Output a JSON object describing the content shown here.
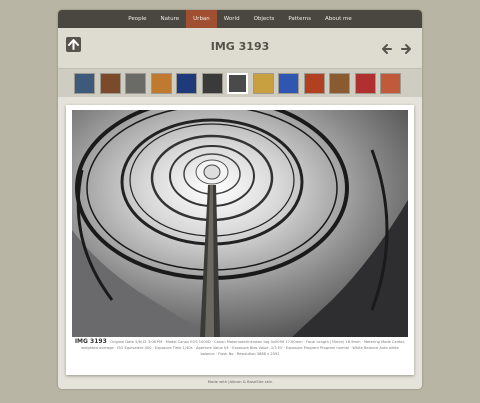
{
  "nav": {
    "items": [
      {
        "label": "People"
      },
      {
        "label": "Nature"
      },
      {
        "label": "Urban"
      },
      {
        "label": "World"
      },
      {
        "label": "Objects"
      },
      {
        "label": "Patterns"
      },
      {
        "label": "About me"
      }
    ],
    "active": "Urban"
  },
  "title": "IMG 3193",
  "thumbnails": [
    {
      "color": "#3d5a7a"
    },
    {
      "color": "#7a4a2a"
    },
    {
      "color": "#6a6a66"
    },
    {
      "color": "#c07a30"
    },
    {
      "color": "#1f3a7a"
    },
    {
      "color": "#3a3a3a"
    },
    {
      "color": "#4a4a4a"
    },
    {
      "color": "#c8a040"
    },
    {
      "color": "#2f56b0"
    },
    {
      "color": "#b04020"
    },
    {
      "color": "#8a5a30"
    },
    {
      "color": "#b03030"
    },
    {
      "color": "#c05a3a"
    }
  ],
  "caption": {
    "name": "IMG 3193",
    "text": "· Original Date 5/6/12 3:06 PM · Model Canon EOS 1000D · Canon MakernoteUnknown tag 0x0090 17.00mm · Focal Length (35mm) 18.9mm · Metering Mode Center-weighted average · ISO Equivalent 400 · Exposure Time 1/40s · Aperture Value f/4 · Exposure Bias Value -1/3 EV · Exposure Program Program normal · White Balance Auto white balance · Flash No · Resolution 3888 x 2592"
  },
  "footer": {
    "text": "Made with jAlbum & BaseSite skin"
  },
  "colors": {
    "nav_bg": "#4a4640",
    "active": "#a05030",
    "page_bg": "#b9b5a4"
  }
}
